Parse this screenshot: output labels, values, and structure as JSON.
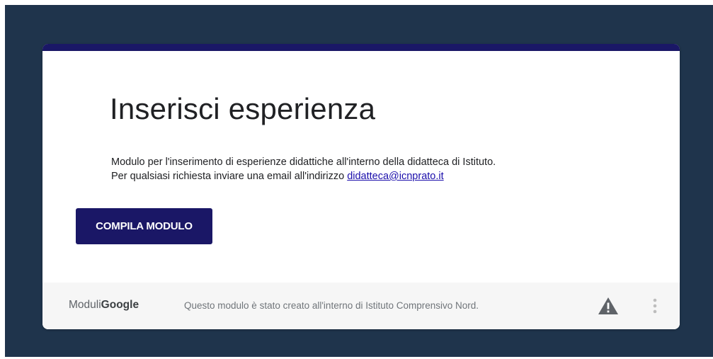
{
  "form": {
    "title": "Inserisci esperienza",
    "description_line1": "Modulo per l'inserimento di esperienze didattiche all'interno della didatteca di Istituto.",
    "description_line2_prefix": "Per qualsiasi richiesta inviare una email all'indirizzo ",
    "email_link": "didatteca@icnprato.it",
    "button_label": "COMPILA MODULO"
  },
  "footer": {
    "brand_moduli": "Moduli",
    "brand_google": "Google",
    "notice": "Questo modulo è stato creato all'interno di Istituto Comprensivo Nord.",
    "warning_icon": "warning-triangle-icon",
    "more_icon": "more-vertical-icon"
  },
  "colors": {
    "background": "#1f344c",
    "accent": "#1a1766",
    "link": "#1a0dab",
    "footer_bg": "#f6f6f6"
  }
}
